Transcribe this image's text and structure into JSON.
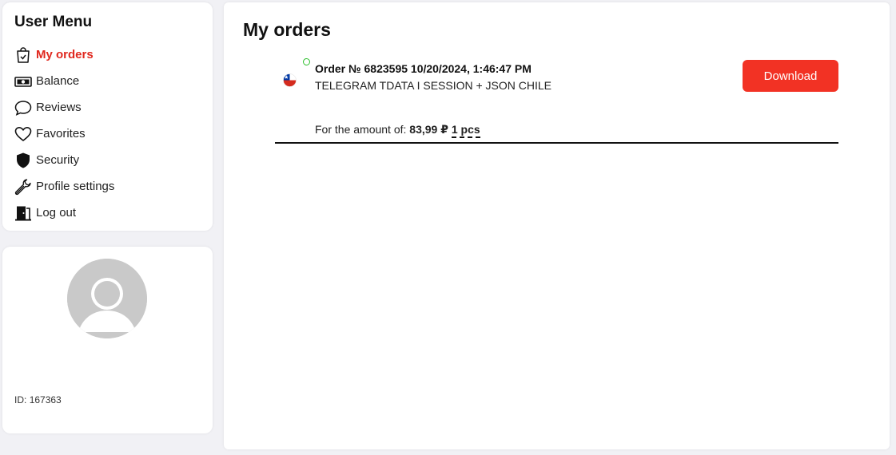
{
  "sidebar": {
    "title": "User Menu",
    "items": [
      {
        "label": "My orders",
        "icon": "shopping-bag-icon",
        "active": true
      },
      {
        "label": "Balance",
        "icon": "banknote-icon"
      },
      {
        "label": "Reviews",
        "icon": "speech-bubble-icon"
      },
      {
        "label": "Favorites",
        "icon": "heart-icon"
      },
      {
        "label": "Security",
        "icon": "shield-icon"
      },
      {
        "label": "Profile settings",
        "icon": "wrench-icon"
      },
      {
        "label": "Log out",
        "icon": "door-exit-icon"
      }
    ]
  },
  "profile": {
    "avatar_icon": "user-avatar-placeholder",
    "id_label": "ID:",
    "id_value": "167363"
  },
  "main": {
    "title": "My orders",
    "orders": [
      {
        "title": "Order № 6823595 10/20/2024, 1:46:47 PM",
        "product": "TELEGRAM TDATA I SESSION + JSON CHILE",
        "amount_label": "For the amount of:",
        "amount": "83,99 ₽",
        "quantity": "1 pcs",
        "download_label": "Download",
        "status_icon": "status-circle-icon",
        "flag_icon": "chile-flag-icon"
      }
    ]
  },
  "colors": {
    "accent": "#e0281e",
    "button": "#f23224",
    "status": "#2ec02e",
    "background": "#f1f1f5"
  }
}
